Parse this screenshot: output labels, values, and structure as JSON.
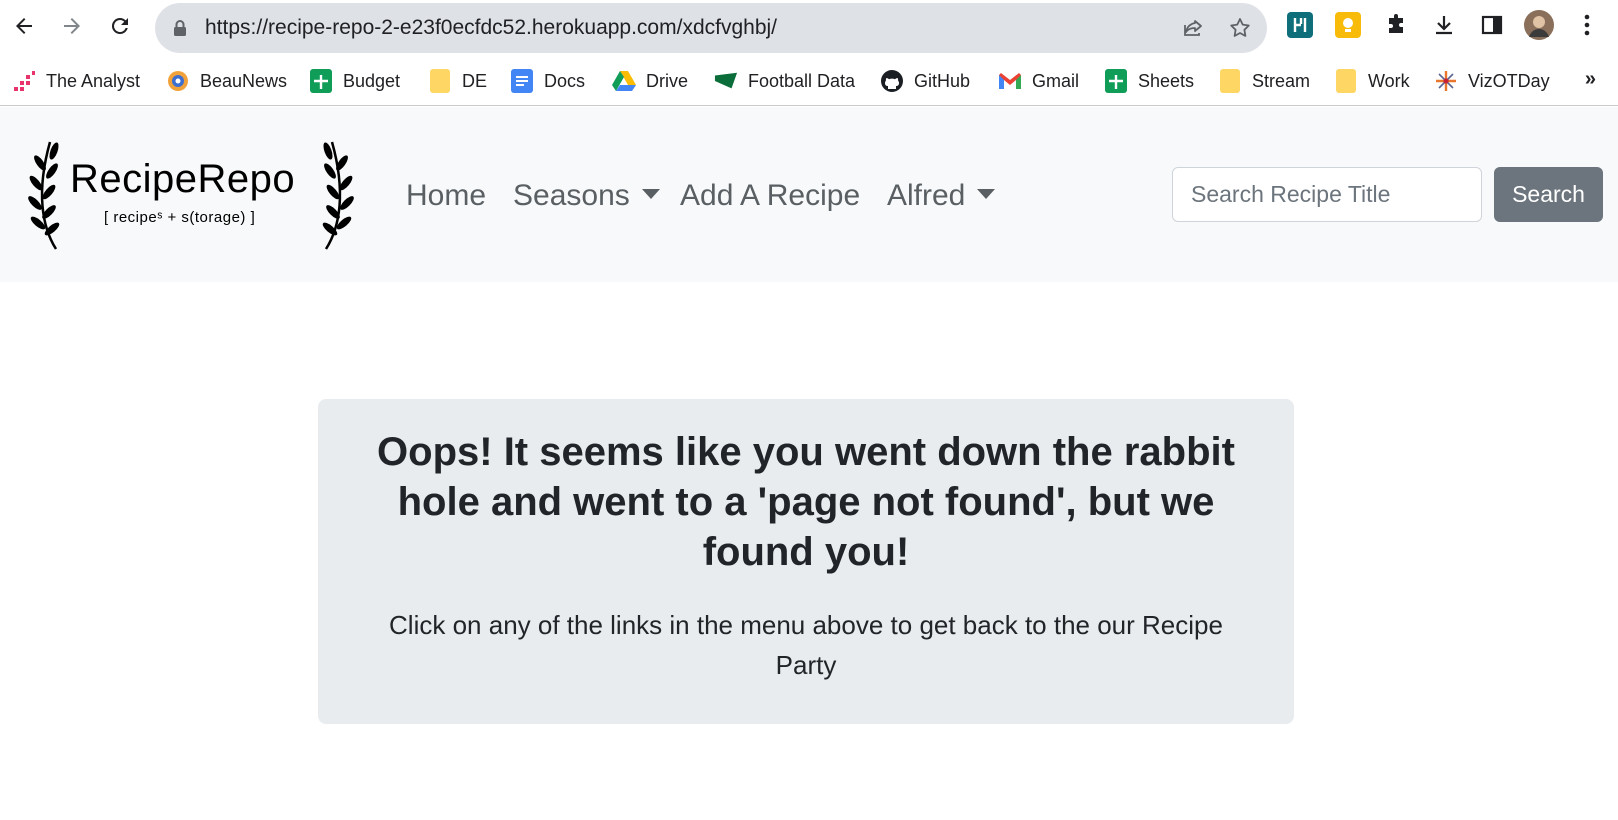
{
  "browser": {
    "url": "https://recipe-repo-2-e23f0ecfdc52.herokuapp.com/xdcfvghbj/",
    "nav_icons": [
      "back-arrow-icon",
      "forward-arrow-icon",
      "reload-icon"
    ],
    "bookmarks": [
      {
        "label": "The Analyst",
        "icon": "analyst-icon"
      },
      {
        "label": "BeauNews",
        "icon": "beaunews-icon"
      },
      {
        "label": "Budget",
        "icon": "sheets-icon"
      },
      {
        "label": "DE",
        "icon": "folder-icon"
      },
      {
        "label": "Docs",
        "icon": "docs-icon"
      },
      {
        "label": "Drive",
        "icon": "drive-icon"
      },
      {
        "label": "Football Data",
        "icon": "football-data-icon"
      },
      {
        "label": "GitHub",
        "icon": "github-icon"
      },
      {
        "label": "Gmail",
        "icon": "gmail-icon"
      },
      {
        "label": "Sheets",
        "icon": "sheets-icon"
      },
      {
        "label": "Stream",
        "icon": "folder-icon"
      },
      {
        "label": "Work",
        "icon": "folder-icon"
      },
      {
        "label": "VizOTDay",
        "icon": "tableau-icon"
      }
    ],
    "more_bookmarks": "»"
  },
  "site": {
    "brand": {
      "title": "RecipeRepo",
      "subtitle": "[ recipeˢ + s(torage) ]"
    },
    "nav": {
      "home": "Home",
      "seasons": "Seasons",
      "add_recipe": "Add A Recipe",
      "user": "Alfred"
    },
    "search": {
      "placeholder": "Search Recipe Title",
      "button": "Search"
    }
  },
  "error": {
    "heading": "Oops! It seems like you went down the rabbit hole and went to a 'page not found', but we found you!",
    "message": "Click on any of the links in the menu above to get back to the our Recipe Party"
  },
  "colors": {
    "navbar_bg": "#f8f9fa",
    "card_bg": "#e9ecef",
    "search_button": "#6c757d",
    "nav_link": "#5a5f63"
  }
}
